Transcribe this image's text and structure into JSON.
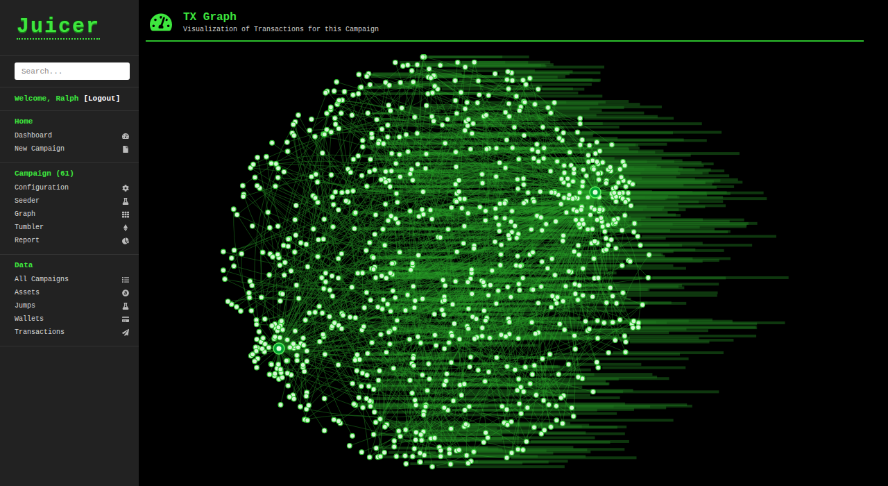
{
  "app": {
    "logo": "Juicer"
  },
  "search": {
    "placeholder": "Search..."
  },
  "user": {
    "greeting": "Welcome, Ralph",
    "logout": "[Logout]"
  },
  "sidebar": {
    "sections": [
      {
        "title": "Home",
        "items": [
          {
            "label": "Dashboard"
          },
          {
            "label": "New Campaign"
          }
        ]
      },
      {
        "title": "Campaign (61)",
        "items": [
          {
            "label": "Configuration"
          },
          {
            "label": "Seeder"
          },
          {
            "label": "Graph"
          },
          {
            "label": "Tumbler"
          },
          {
            "label": "Report"
          }
        ]
      },
      {
        "title": "Data",
        "items": [
          {
            "label": "All Campaigns"
          },
          {
            "label": "Assets"
          },
          {
            "label": "Jumps"
          },
          {
            "label": "Wallets"
          },
          {
            "label": "Transactions"
          }
        ]
      }
    ]
  },
  "header": {
    "title": "TX Graph",
    "subtitle": "Visualization of Transactions for this Campaign"
  }
}
